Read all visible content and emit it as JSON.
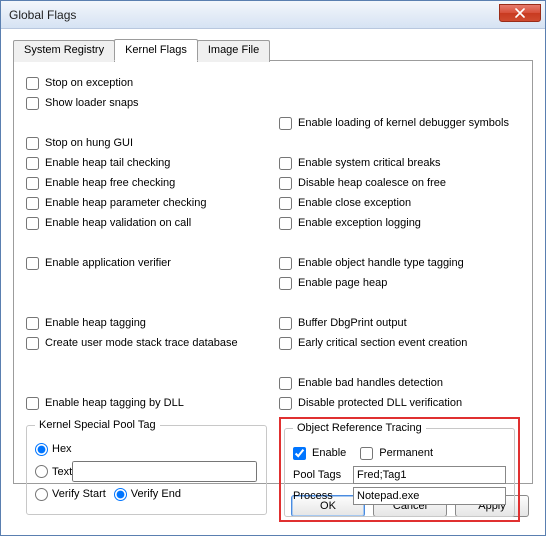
{
  "window": {
    "title": "Global Flags"
  },
  "tabs": {
    "items": [
      {
        "label": "System Registry"
      },
      {
        "label": "Kernel Flags"
      },
      {
        "label": "Image File"
      }
    ]
  },
  "left": {
    "stop_exception": "Stop on exception",
    "show_loader": "Show loader snaps",
    "stop_hung": "Stop on hung GUI",
    "heap_tail": "Enable heap tail checking",
    "heap_free": "Enable heap free checking",
    "heap_param": "Enable heap parameter checking",
    "heap_valid": "Enable heap validation on call",
    "app_verifier": "Enable application verifier",
    "heap_tag": "Enable heap tagging",
    "umst": "Create user mode stack trace database",
    "heap_tag_dll": "Enable heap tagging by DLL"
  },
  "right": {
    "load_sym": "Enable loading of kernel debugger symbols",
    "sys_crit": "Enable system critical breaks",
    "heap_coalesce": "Disable heap coalesce on free",
    "close_exc": "Enable close exception",
    "exc_log": "Enable exception logging",
    "obj_handle": "Enable object handle type tagging",
    "page_heap": "Enable page heap",
    "dbgprint": "Buffer DbgPrint output",
    "early_crit": "Early critical section event creation",
    "bad_handles": "Enable bad handles detection",
    "dll_verif": "Disable protected DLL verification"
  },
  "kspt": {
    "legend": "Kernel Special Pool Tag",
    "hex": "Hex",
    "text": "Text",
    "verify_start": "Verify Start",
    "verify_end": "Verify End",
    "tag_value": ""
  },
  "ort": {
    "legend": "Object Reference Tracing",
    "enable": "Enable",
    "permanent": "Permanent",
    "pool_tags_label": "Pool Tags",
    "pool_tags_value": "Fred;Tag1",
    "process_label": "Process",
    "process_value": "Notepad.exe"
  },
  "buttons": {
    "ok": "OK",
    "cancel": "Cancel",
    "apply": "Apply"
  }
}
